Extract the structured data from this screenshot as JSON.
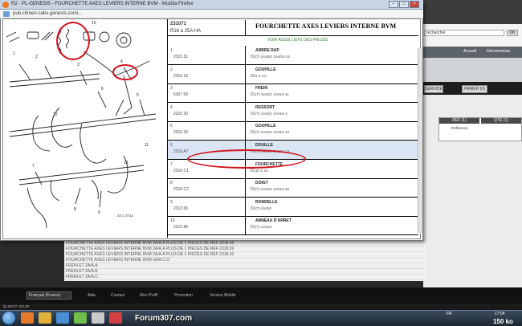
{
  "popup": {
    "title": "R2 - PL-GENESIS - FOURCHETTE AXES LEVIERS INTERNE BVM - Mozilla Firefox",
    "url": "pub.citroen-cabs.genesis.com/..."
  },
  "header": {
    "code": "231071",
    "sub": "R16 à 25A HA",
    "title": "FOURCHETTE AXES LEVIERS INTERNE BVM",
    "link": "VOIR AUSSI LISTE DES PIECES"
  },
  "parts": [
    {
      "num": "1",
      "ref": "2315 31",
      "qty": "01",
      "name": "ARBRE RAP",
      "detail": "(T) 2A400; 2A401+12"
    },
    {
      "num": "2",
      "ref": "2316 10",
      "qty": "01",
      "name": "GOUPILLE",
      "detail": "6 X 24"
    },
    {
      "num": "3",
      "ref": "6207 09",
      "qty": "01",
      "name": "FREIN",
      "detail": "(T) 3A010; 2A010-11"
    },
    {
      "num": "4",
      "ref": "2310 20",
      "qty": "01",
      "name": "RESSORT",
      "detail": "(T) 2A010; 2A010-1"
    },
    {
      "num": "5",
      "ref": "2316 20",
      "qty": "01",
      "name": "GOUPILLE",
      "detail": "(T) 2A010; 2A010-12"
    },
    {
      "num": "6",
      "ref": "2316 A7",
      "qty": "01",
      "name": "DOUILLE",
      "detail": "(T) 2A010; 2A010-13"
    },
    {
      "num": "7",
      "ref": "2316 C1",
      "qty": "01",
      "name": "FOURCHETTE",
      "detail": "10 X 22"
    },
    {
      "num": "8",
      "ref": "2316 C2",
      "qty": "01",
      "name": "DOIGT",
      "detail": "(T) 2A010; 2A010-16"
    },
    {
      "num": "9",
      "ref": "2313 65",
      "qty": "01",
      "name": "RONDELLE",
      "detail": "(T) 2A010"
    },
    {
      "num": "10",
      "ref": "2313 80",
      "qty": "01",
      "name": "ANNEAU D'ARRET",
      "detail": "(T) 2A010"
    }
  ],
  "diagram": {
    "code": "23 1 0714",
    "callouts": [
      "1",
      "2",
      "3",
      "4",
      "5",
      "6",
      "7",
      "8",
      "9",
      "10",
      "11",
      "12",
      "13"
    ]
  },
  "background": {
    "search_placeholder": "rechercher",
    "search_btn": "OK",
    "nav_links": [
      "Accueil",
      "Déconnexion"
    ],
    "tabs": [
      "SERVICES",
      "PANIER (0)"
    ],
    "table_head": [
      "RÉF (1)",
      "QTÉ (1)"
    ],
    "table_cell": "Référence",
    "rows": [
      "FOURCHETTE AXES LEVIERS INTERNE BVM   2A/A.A    PLUS DE 1 PIECES DE REF 2318.05",
      "FOURCHETTE AXES LEVIERS INTERNE BVM   2A/A.A    PLUS DE 1 PIECES DE REF 2318.09",
      "FOURCHETTE AXES LEVIERS INTERNE BVM   2A/A.A    PLUS DE 1 PIECES DE REF 2318.10",
      "FOURCHETTE AXES LEVIERS INTERNE BVM   2A/A.C.O",
      "FREIN ET    2A/A.A",
      "FREIN ET    2A/A.B",
      "FREIN ET    2A/A.C"
    ]
  },
  "footer": {
    "lang": "Français (France)",
    "links": [
      "Aide",
      "Contact",
      "Mon Profil",
      "Promotion",
      "Version Mobile"
    ],
    "small": "fpi 00:07 152.00"
  },
  "taskbar": {
    "watermark": "Forum307.com",
    "tray": "FR",
    "clock": "17:04",
    "speed": "150 ko"
  },
  "colors": {
    "annotation": "#d2141e",
    "highlight_row": "#dbe6f5"
  }
}
